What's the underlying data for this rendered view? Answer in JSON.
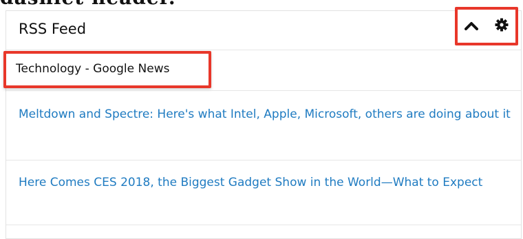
{
  "page_heading": "dashlet header.",
  "dashlet": {
    "title": "RSS Feed",
    "actions": {
      "collapse_icon": "chevron-up-icon",
      "settings_icon": "gear-icon"
    },
    "feed_title": "Technology - Google News",
    "items": [
      {
        "title": "Meltdown and Spectre: Here's what Intel, Apple, Microsoft, others are doing about it"
      },
      {
        "title": "Here Comes CES 2018, the Biggest Gadget Show in the World—What to Expect"
      }
    ]
  },
  "colors": {
    "highlight_border": "#e8372a",
    "link": "#1f7bc1",
    "divider": "#e6e6e6"
  }
}
